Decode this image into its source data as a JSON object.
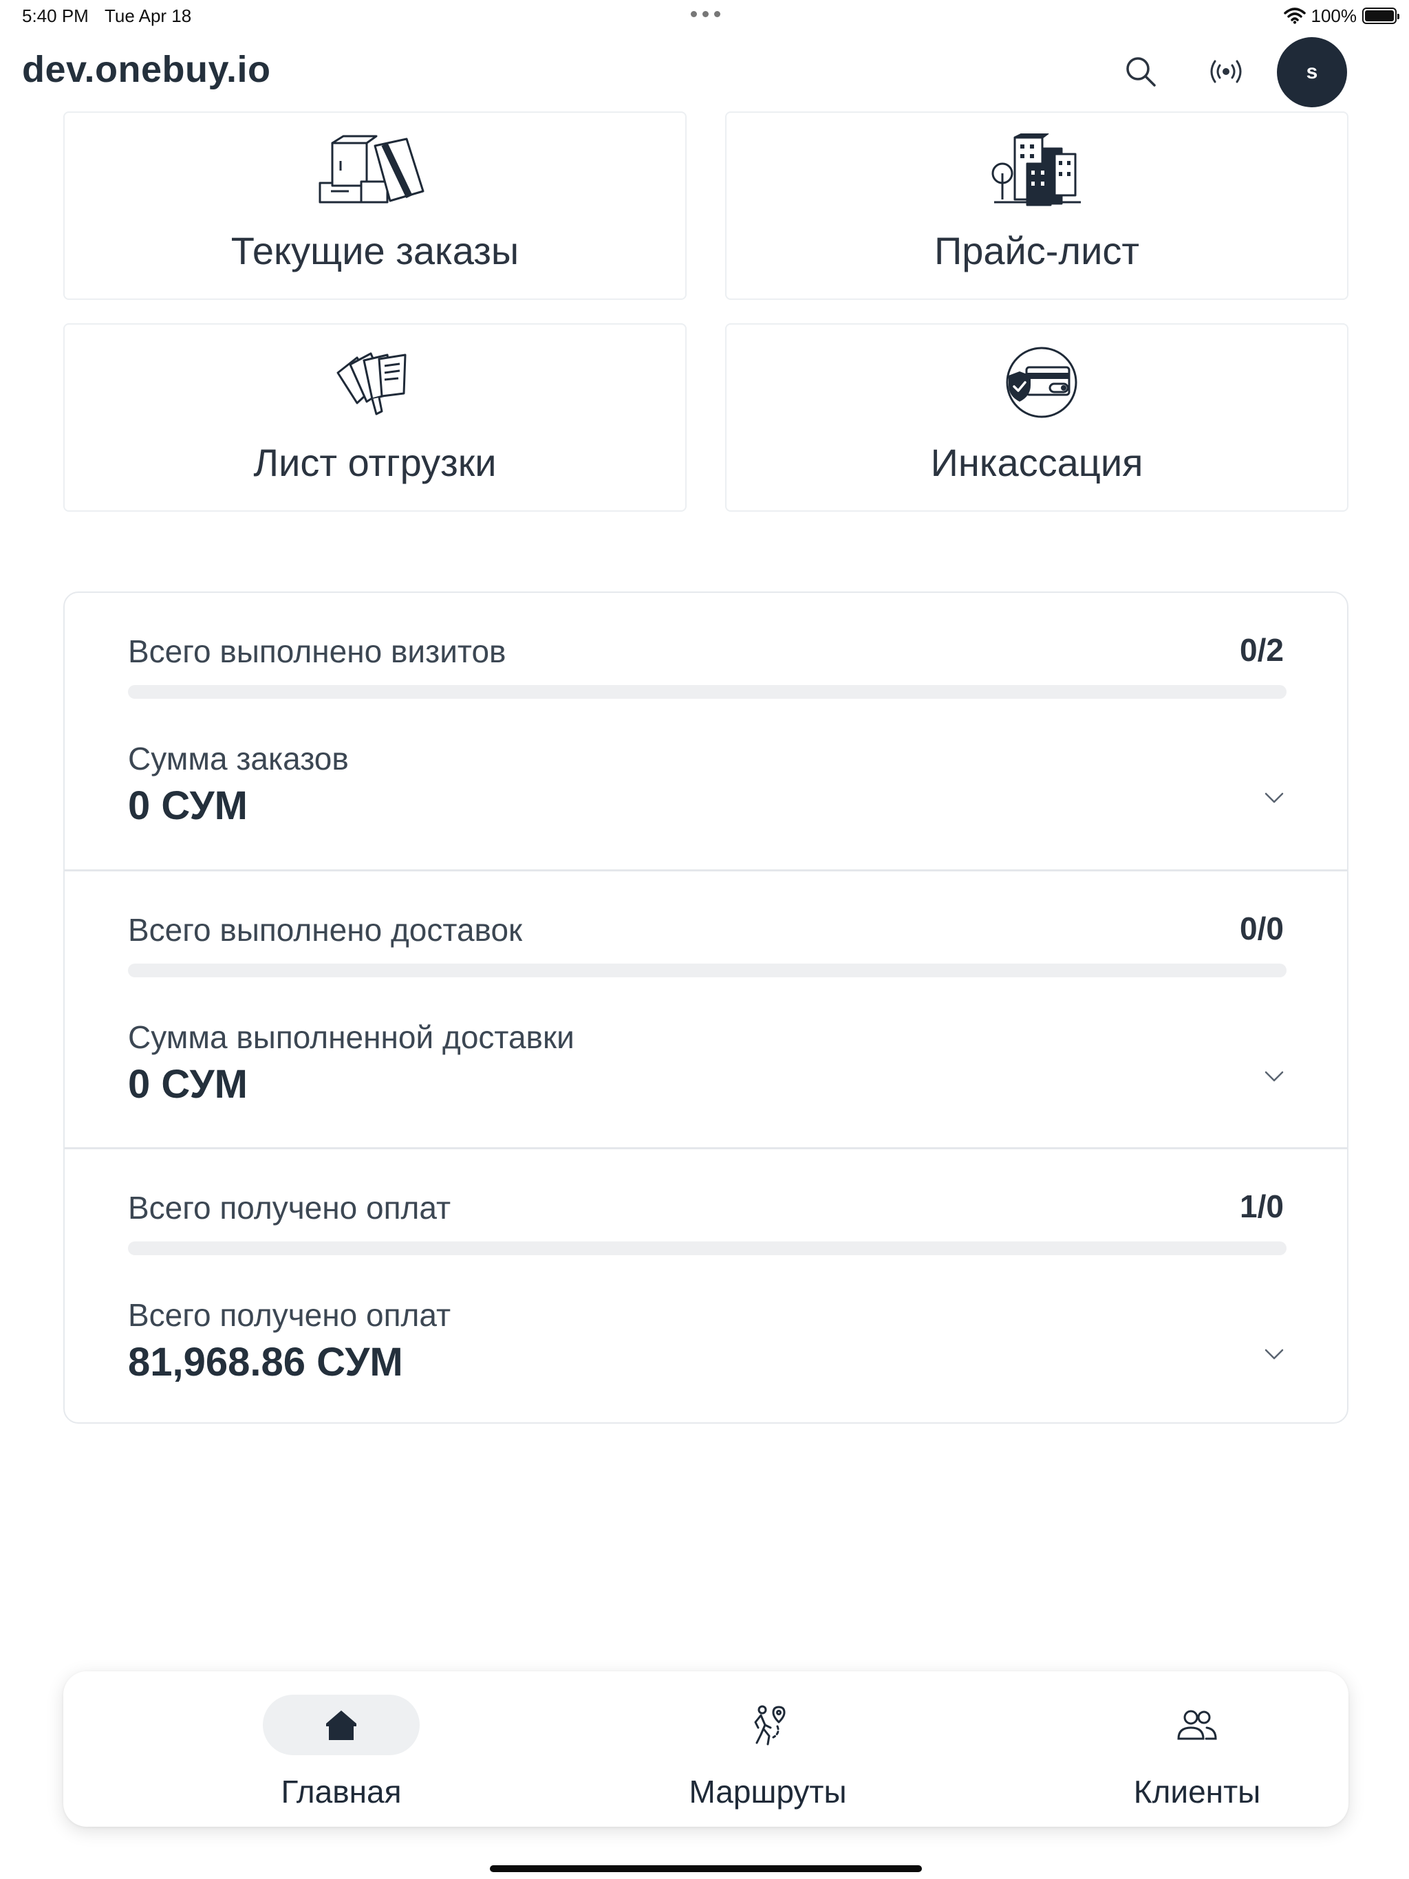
{
  "status_bar": {
    "time": "5:40 PM",
    "date": "Tue Apr 18",
    "battery": "100%"
  },
  "header": {
    "title": "dev.onebuy.io",
    "avatar_initial": "s",
    "icons": [
      "search-icon",
      "broadcast-icon"
    ]
  },
  "tiles": [
    {
      "label": "Текущие заказы",
      "icon": "boxes-icon"
    },
    {
      "label": "Прайс-лист",
      "icon": "buildings-icon"
    },
    {
      "label": "Лист отгрузки",
      "icon": "documents-icon"
    },
    {
      "label": "Инкассация",
      "icon": "secure-card-icon"
    }
  ],
  "stats": [
    {
      "label": "Всего выполнено визитов",
      "ratio": "0/2",
      "progress": 0,
      "sum_label": "Сумма заказов",
      "sum_value": "0 СУМ"
    },
    {
      "label": "Всего выполнено доставок",
      "ratio": "0/0",
      "progress": 0,
      "sum_label": "Сумма выполненной доставки",
      "sum_value": "0 СУМ"
    },
    {
      "label": "Всего получено оплат",
      "ratio": "1/0",
      "progress": 0,
      "sum_label": "Всего получено оплат",
      "sum_value": "81,968.86 СУМ"
    }
  ],
  "bottom_nav": [
    {
      "label": "Главная",
      "icon": "home-icon",
      "active": true
    },
    {
      "label": "Маршруты",
      "icon": "walking-route-icon",
      "active": false
    },
    {
      "label": "Клиенты",
      "icon": "users-icon",
      "active": false
    }
  ],
  "colors": {
    "primary": "#1f2a38",
    "text": "#2b3440",
    "track": "#eeeff1",
    "border": "#e6e9ed"
  }
}
